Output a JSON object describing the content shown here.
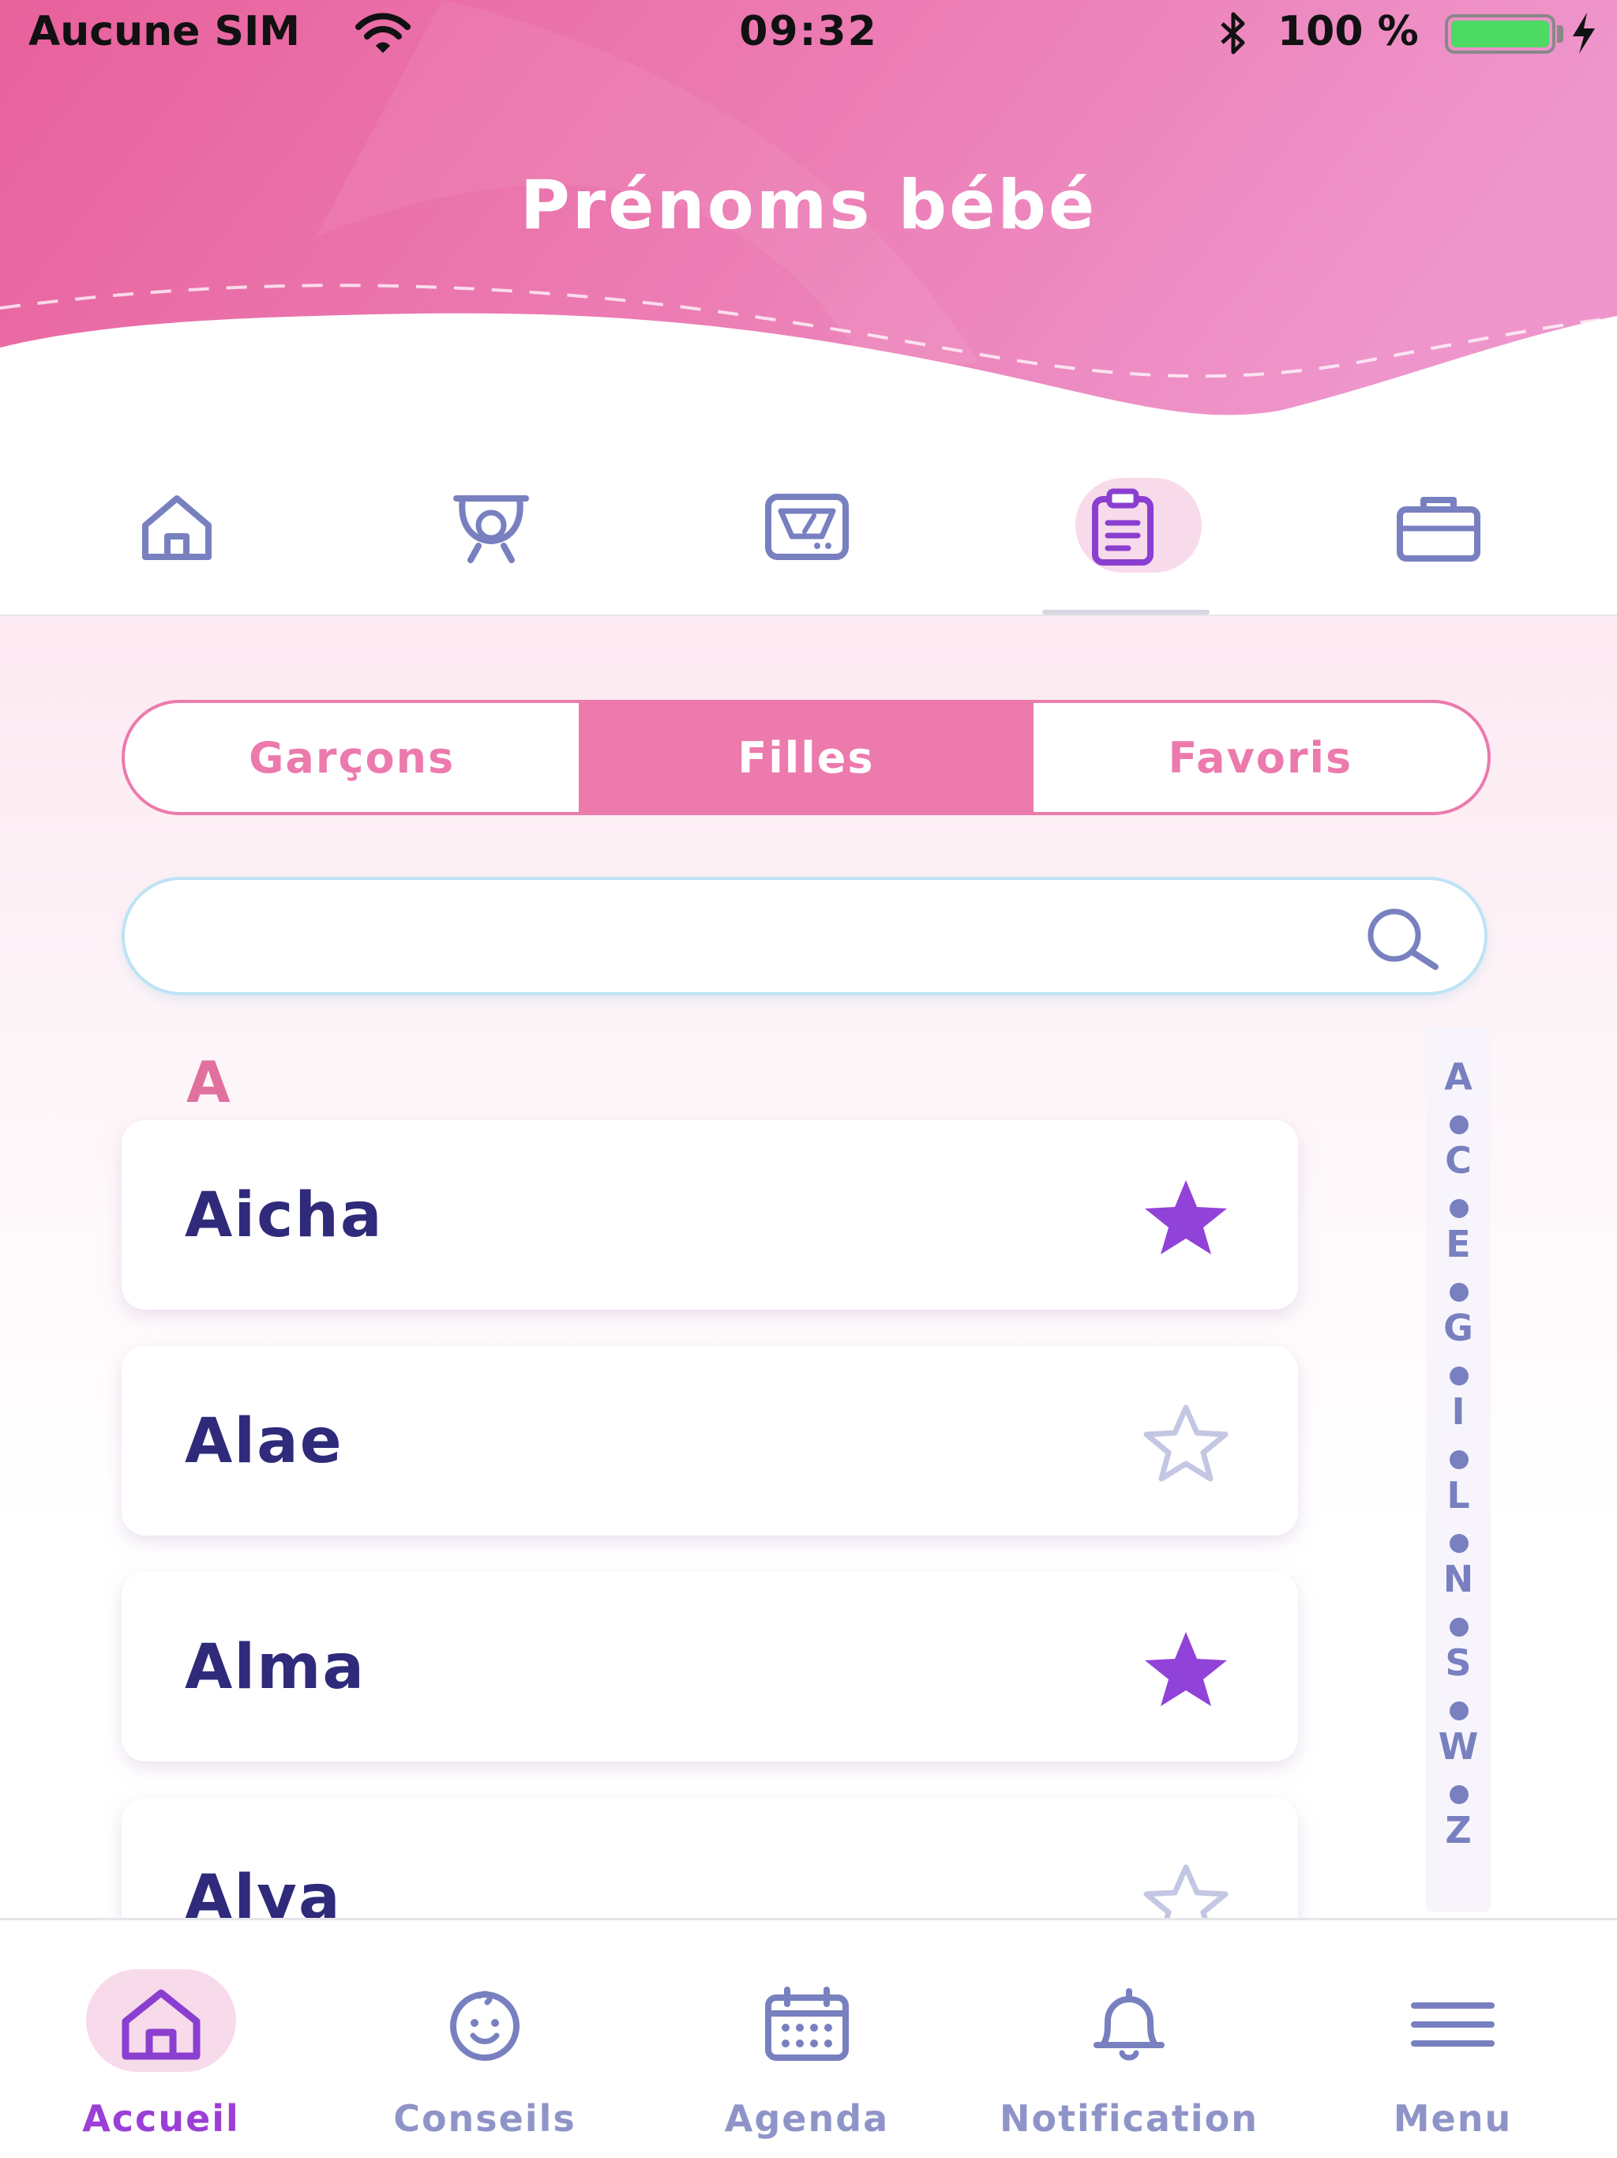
{
  "status_bar": {
    "carrier": "Aucune SIM",
    "time": "09:32",
    "battery_text": "100 %",
    "battery_level": 1.0,
    "icons": [
      "wifi-icon",
      "bluetooth-icon",
      "battery-icon",
      "charging-bolt-icon"
    ]
  },
  "header": {
    "title": "Prénoms bébé"
  },
  "top_nav": {
    "items": [
      {
        "icon": "home-icon"
      },
      {
        "icon": "baby-scale-icon"
      },
      {
        "icon": "weighing-scale-icon"
      },
      {
        "icon": "clipboard-icon",
        "active": true
      },
      {
        "icon": "briefcase-icon"
      }
    ]
  },
  "segments": {
    "boys": "Garçons",
    "girls": "Filles",
    "favorites": "Favoris",
    "active": "Filles"
  },
  "search": {
    "value": "",
    "placeholder": ""
  },
  "list": {
    "section_letter": "A",
    "names": [
      {
        "name": "Aicha",
        "favorite": true
      },
      {
        "name": "Alae",
        "favorite": false
      },
      {
        "name": "Alma",
        "favorite": true
      },
      {
        "name": "Alya",
        "favorite": false
      }
    ]
  },
  "alpha_index": {
    "letters": [
      "A",
      "C",
      "E",
      "G",
      "I",
      "L",
      "N",
      "S",
      "W",
      "Z"
    ]
  },
  "bottom_tabs": {
    "home": "Accueil",
    "tips": "Conseils",
    "agenda": "Agenda",
    "notification": "Notification",
    "menu": "Menu",
    "active": "Accueil"
  },
  "colors": {
    "pink_accent": "#ec7aad",
    "header_pink": "#e95f9a",
    "navy_text": "#2f2a7a",
    "icon_lavender": "#7880c0",
    "star_purple": "#9142d9",
    "active_tab_purple": "#9b3fd6"
  }
}
